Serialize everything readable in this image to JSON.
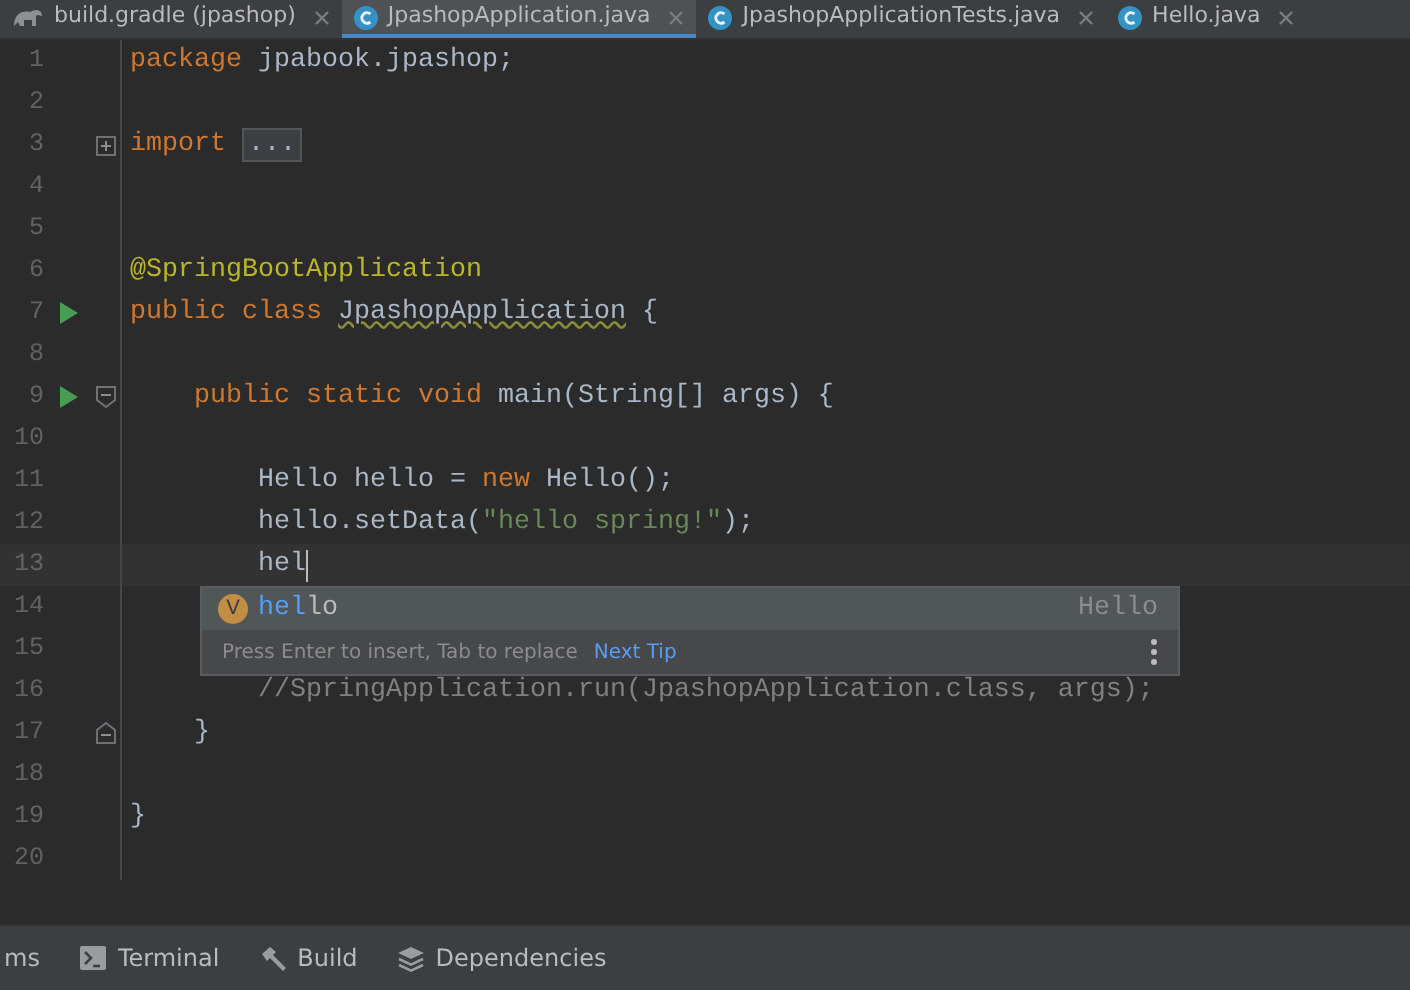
{
  "tabs": [
    {
      "label": "build.gradle (jpashop)",
      "kind": "gradle",
      "selected": false
    },
    {
      "label": "JpashopApplication.java",
      "kind": "java",
      "selected": true
    },
    {
      "label": "JpashopApplicationTests.java",
      "kind": "java",
      "selected": false
    },
    {
      "label": "Hello.java",
      "kind": "java",
      "selected": false
    }
  ],
  "lines": [
    {
      "number": "1",
      "tokens": [
        {
          "kind": "keyword",
          "text": "package "
        },
        {
          "kind": "plain",
          "text": "jpabook.jpashop;"
        }
      ]
    },
    {
      "number": "2"
    },
    {
      "number": "3",
      "fold_collapsed": true,
      "tokens": [
        {
          "kind": "keyword",
          "text": "import "
        },
        {
          "kind": "folded",
          "text": "..."
        }
      ]
    },
    {
      "number": "4"
    },
    {
      "number": "5"
    },
    {
      "number": "6",
      "tokens": [
        {
          "kind": "annotation",
          "text": "@SpringBootApplication"
        }
      ]
    },
    {
      "number": "7",
      "run": true,
      "tokens": [
        {
          "kind": "keyword",
          "text": "public class "
        },
        {
          "kind": "warning",
          "text": "JpashopApplication"
        },
        {
          "kind": "plain",
          "text": " {"
        }
      ]
    },
    {
      "number": "8"
    },
    {
      "number": "9",
      "run": true,
      "fold_start": true,
      "tokens": [
        {
          "kind": "keyword",
          "text": "    public static void "
        },
        {
          "kind": "plain",
          "text": "main(String[] args) {"
        }
      ]
    },
    {
      "number": "10"
    },
    {
      "number": "11",
      "tokens": [
        {
          "kind": "plain",
          "text": "        Hello hello = "
        },
        {
          "kind": "keyword",
          "text": "new "
        },
        {
          "kind": "plain",
          "text": "Hello();"
        }
      ]
    },
    {
      "number": "12",
      "tokens": [
        {
          "kind": "plain",
          "text": "        hello.setData("
        },
        {
          "kind": "string",
          "text": "\"hello spring!\""
        },
        {
          "kind": "plain",
          "text": ");"
        }
      ]
    },
    {
      "number": "13",
      "current": true,
      "caret": true,
      "tokens": [
        {
          "kind": "plain",
          "text": "        hel"
        }
      ]
    },
    {
      "number": "14"
    },
    {
      "number": "15"
    },
    {
      "number": "16",
      "tokens": [
        {
          "kind": "comment",
          "text": "        //SpringApplication.run(JpashopApplication.class, args);"
        }
      ]
    },
    {
      "number": "17",
      "fold_end": true,
      "tokens": [
        {
          "kind": "plain",
          "text": "    }"
        }
      ]
    },
    {
      "number": "18"
    },
    {
      "number": "19",
      "tokens": [
        {
          "kind": "plain",
          "text": "}"
        }
      ]
    },
    {
      "number": "20"
    }
  ],
  "completion": {
    "items": [
      {
        "icon": "V",
        "matched": "hel",
        "rest": "lo",
        "type": "Hello",
        "selected": true
      }
    ],
    "hint": "Press Enter to insert, Tab to replace",
    "hint_link": "Next Tip"
  },
  "tool_windows": [
    {
      "label": "ms",
      "kind": "none"
    },
    {
      "label": "Terminal",
      "kind": "terminal"
    },
    {
      "label": "Build",
      "kind": "build"
    },
    {
      "label": "Dependencies",
      "kind": "dependencies"
    }
  ]
}
